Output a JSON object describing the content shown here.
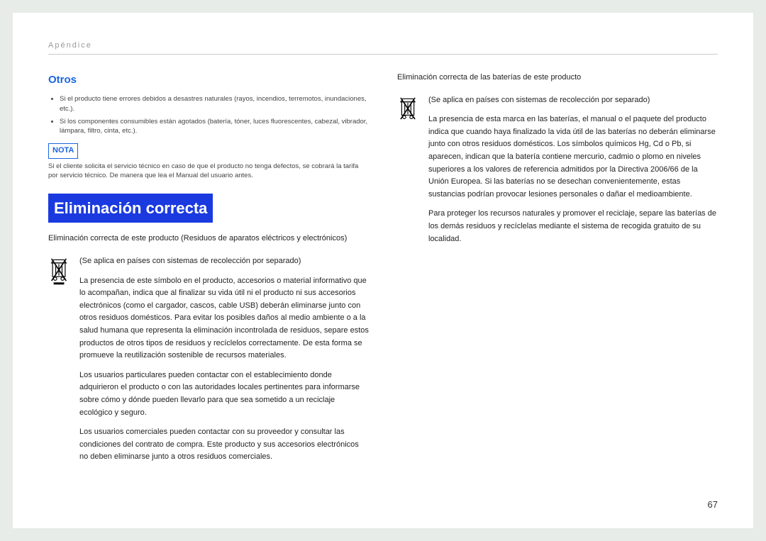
{
  "header": {
    "section": "Apéndice"
  },
  "left": {
    "otros_heading": "Otros",
    "bullet1": "Si el producto tiene errores debidos a desastres naturales (rayos, incendios, terremotos, inundaciones, etc.).",
    "bullet2": "Si los componentes consumibles están agotados (batería, tóner, luces fluorescentes, cabezal, vibrador, lámpara, filtro, cinta, etc.).",
    "nota_label": "NOTA",
    "nota_text": "Si el cliente solicita el servicio técnico en caso de que el producto no tenga defectos, se cobrará la tarifa por servicio técnico. De manera que lea el Manual del usuario antes.",
    "main_heading": "Eliminación correcta",
    "sub1": "Eliminación correcta de este producto (Residuos de aparatos eléctricos y electrónicos)",
    "p1": "(Se aplica en países con sistemas de recolección por separado)",
    "p2": "La presencia de este símbolo en el producto, accesorios o material informativo que lo acompañan, indica que al finalizar su vida útil ni el producto ni sus accesorios electrónicos (como el cargador, cascos, cable USB) deberán eliminarse junto con otros residuos domésticos. Para evitar los posibles daños al medio ambiente o a la salud humana que representa la eliminación incontrolada de residuos, separe estos productos de otros tipos de residuos y recíclelos correctamente. De esta forma se promueve la reutilización sostenible de recursos materiales.",
    "p3": "Los usuarios particulares pueden contactar con el establecimiento donde adquirieron el producto o con las autoridades locales pertinentes para informarse sobre cómo y dónde pueden llevarlo para que sea sometido a un reciclaje ecológico y seguro.",
    "p4": "Los usuarios comerciales pueden contactar con su proveedor y consultar las condiciones del contrato de compra. Este producto y sus accesorios electrónicos no deben eliminarse junto a otros residuos comerciales."
  },
  "right": {
    "sub1": "Eliminación correcta de las baterías de este producto",
    "p1": "(Se aplica en países con sistemas de recolección por separado)",
    "p2": "La presencia de esta marca en las baterías, el manual o el paquete del producto indica que cuando haya finalizado la vida útil de las baterías no deberán eliminarse junto con otros residuos domésticos. Los símbolos químicos Hg, Cd o Pb, si aparecen, indican que la batería contiene mercurio, cadmio o plomo en niveles superiores a los valores de referencia admitidos por la Directiva 2006/66 de la Unión Europea. Si las baterías no se desechan convenientemente, estas sustancias podrían provocar lesiones personales o dañar el medioambiente.",
    "p3": "Para proteger los recursos naturales y promover el reciclaje, separe las baterías de los demás residuos y recíclelas mediante el sistema de recogida gratuito de su localidad."
  },
  "pagenum": "67"
}
